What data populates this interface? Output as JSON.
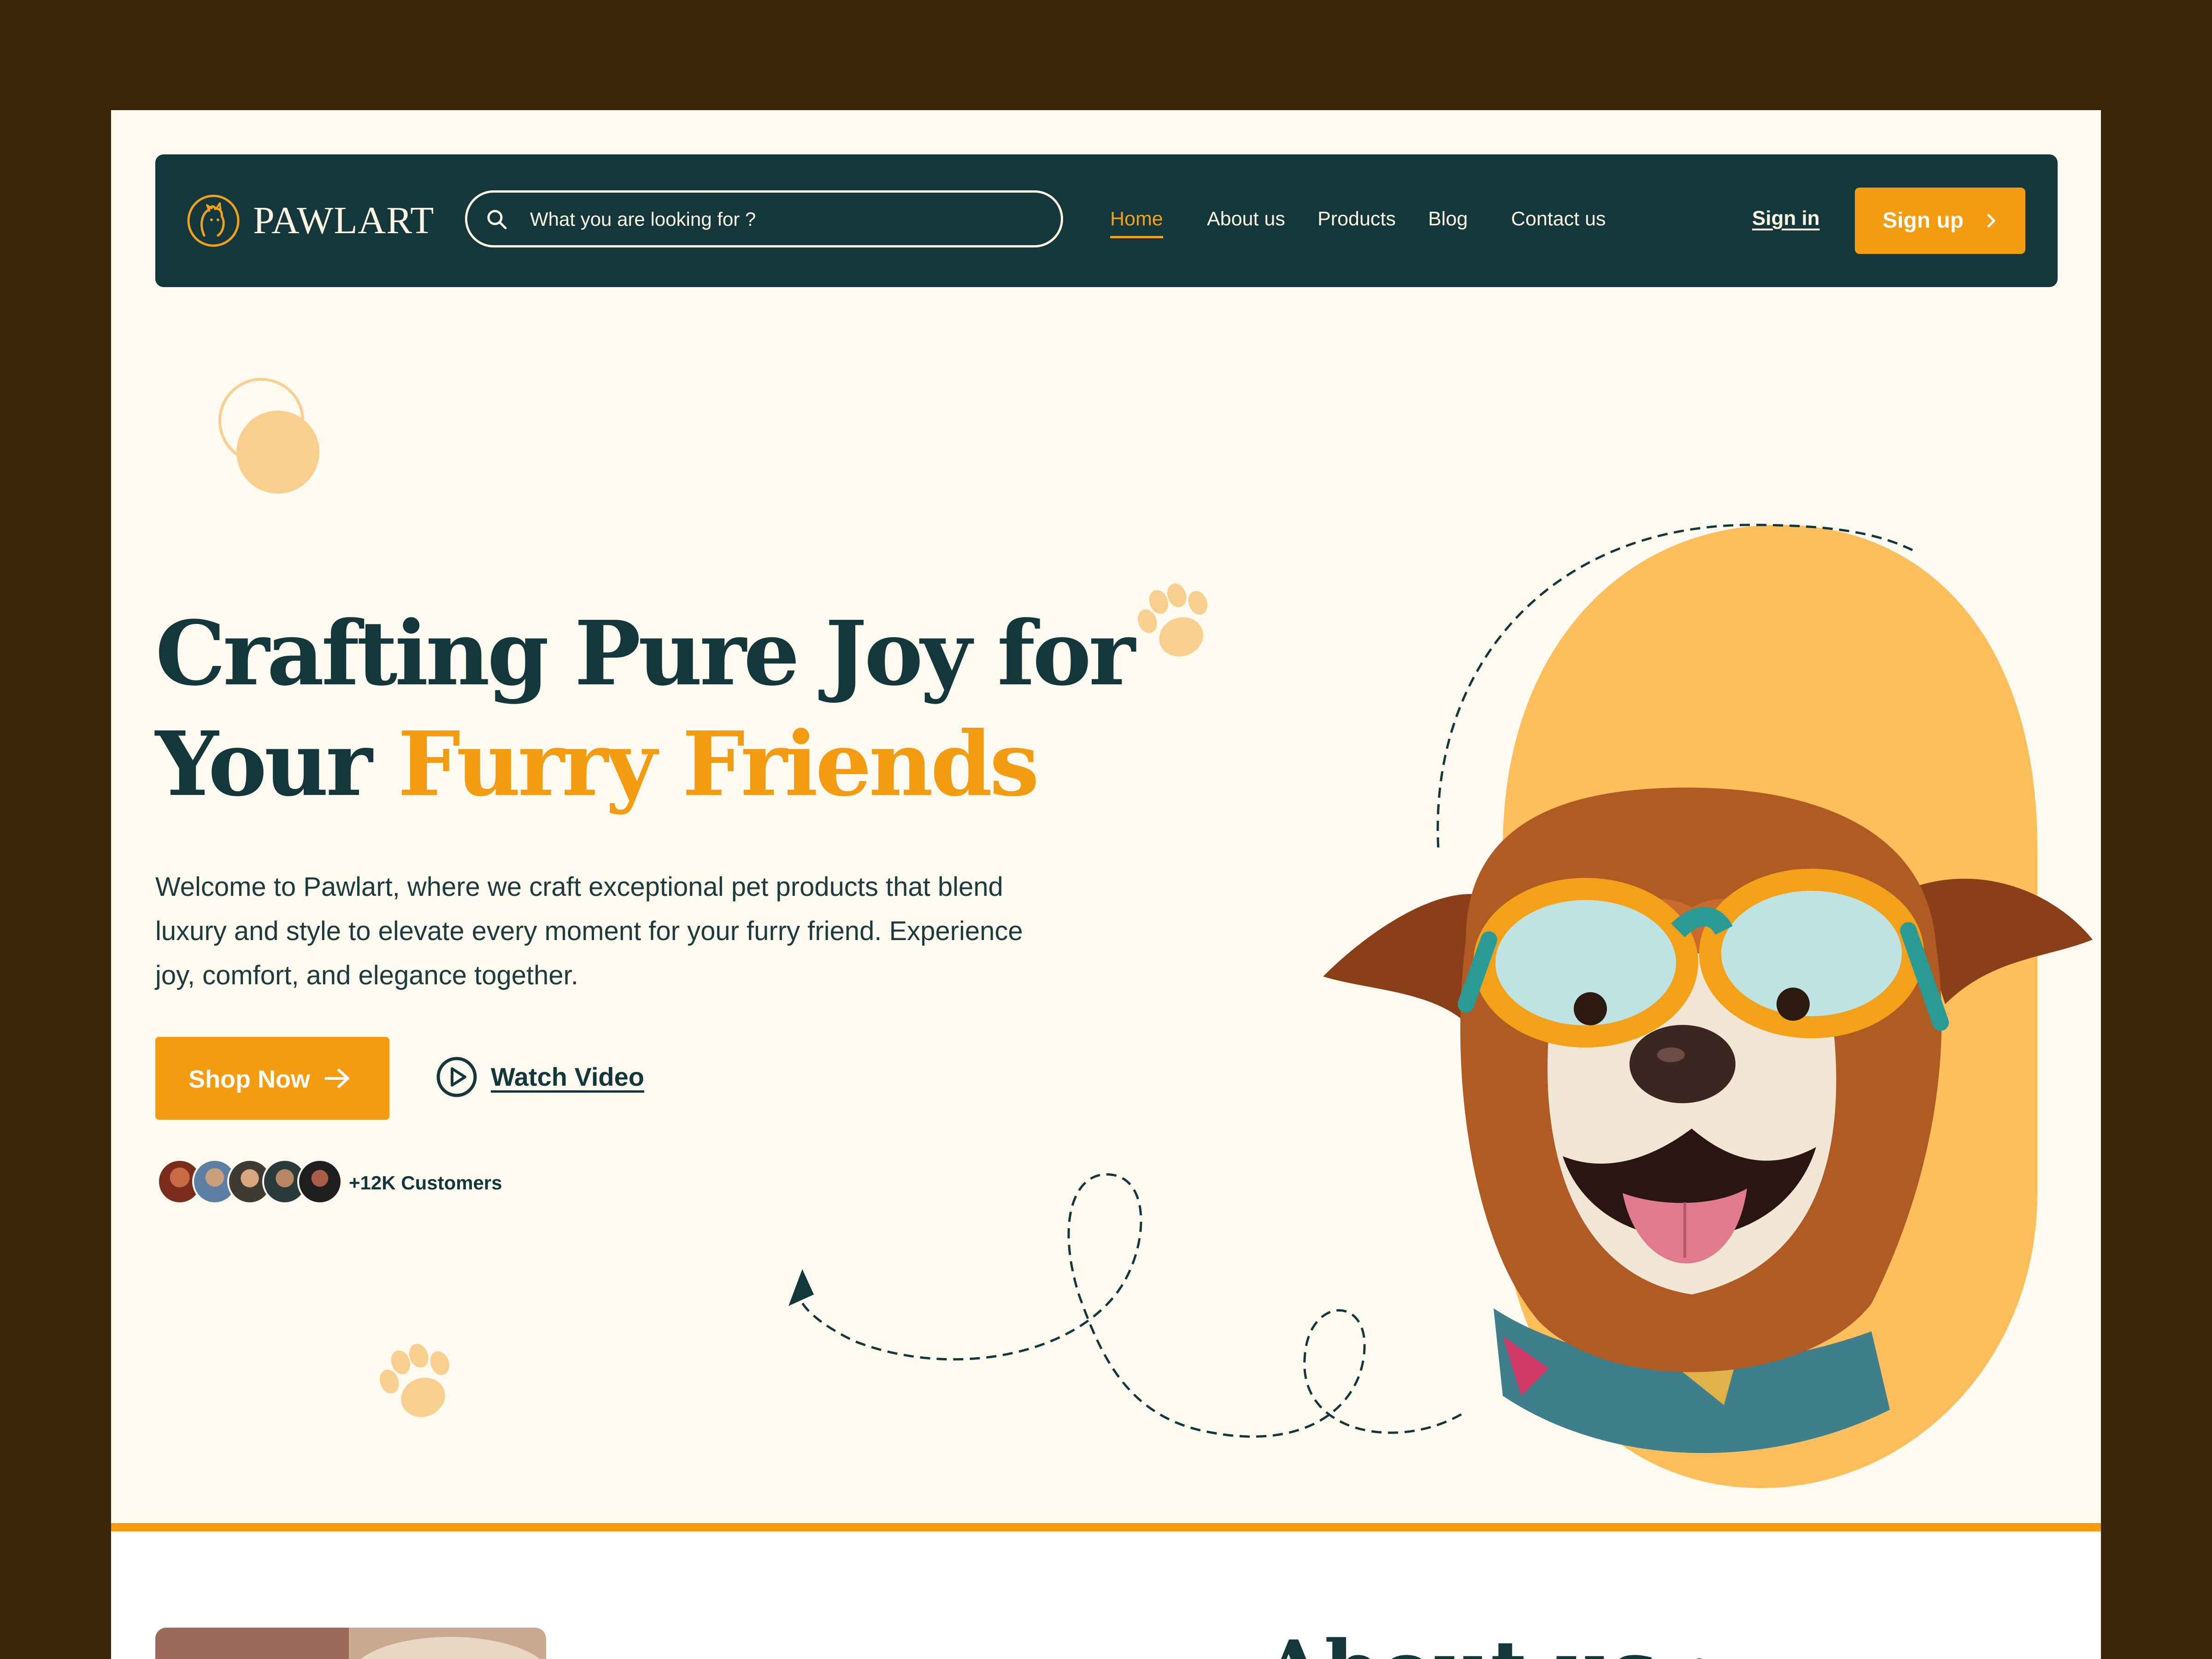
{
  "nav": {
    "brand": "PAWLART",
    "search_placeholder": "What you are looking for ?",
    "links": [
      "Home",
      "About us",
      "Products",
      "Blog",
      "Contact us"
    ],
    "active_link": "Home",
    "sign_in": "Sign in",
    "sign_up": "Sign up"
  },
  "hero": {
    "title_line1": "Crafting Pure Joy for",
    "title_line2_prefix": "Your ",
    "title_line2_accent": "Furry Friends",
    "description": "Welcome to Pawlart, where we craft exceptional pet products that blend luxury and style to elevate every moment for your furry friend. Experience joy, comfort, and elegance together.",
    "shop_button": "Shop Now",
    "watch_button": "Watch Video",
    "customers": "+12K Customers"
  },
  "about": {
    "heading": "About us :"
  },
  "colors": {
    "frame": "#3a2506",
    "page_bg": "#fffaf0",
    "nav_bg": "#13373a",
    "accent": "#f39c12",
    "blob": "#ffbe5c",
    "text_dark": "#13373a"
  },
  "icons": {
    "logo": "dog-cat-logo-icon",
    "search": "search-icon",
    "sign_up": "chevron-right-icon",
    "shop": "arrow-right-icon",
    "watch": "play-circle-icon"
  }
}
